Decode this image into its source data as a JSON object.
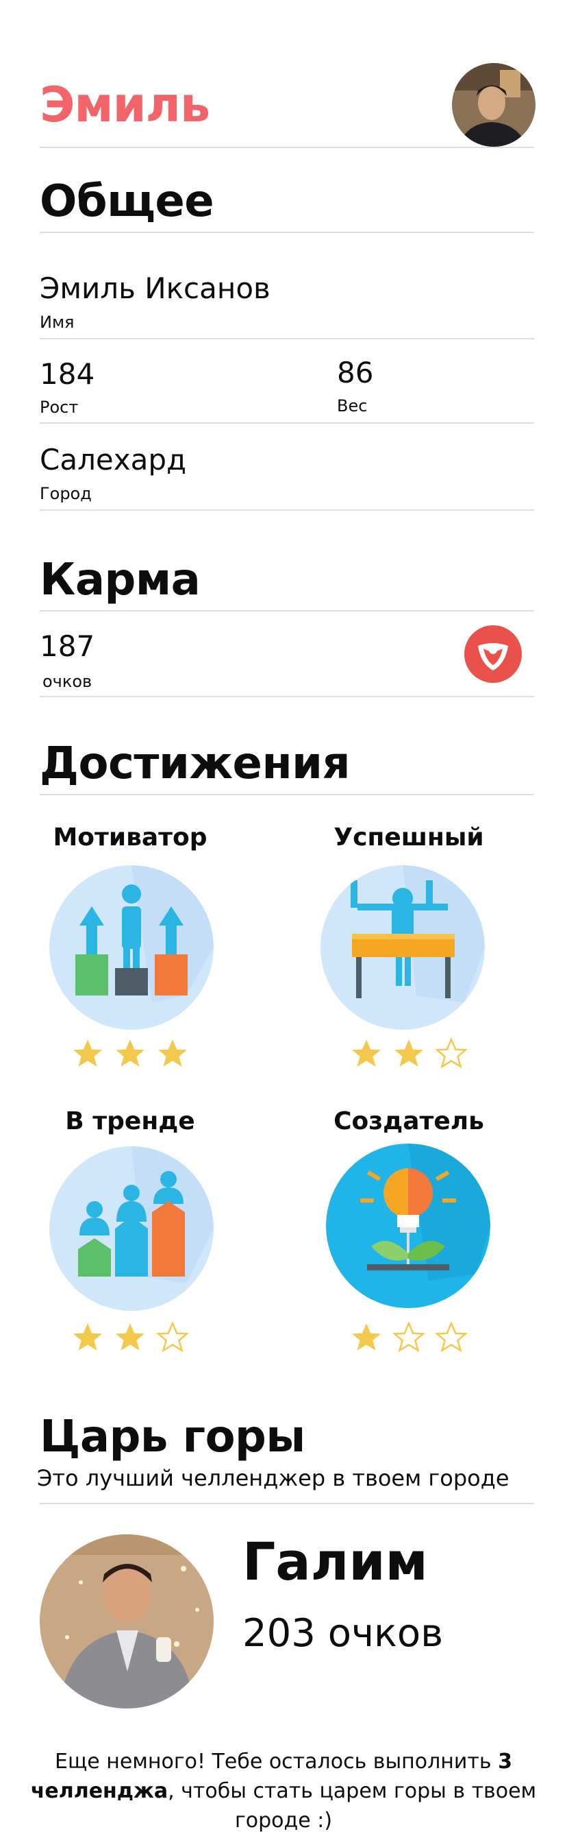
{
  "header": {
    "user_name": "Эмиль"
  },
  "general": {
    "title": "Общее",
    "name": {
      "value": "Эмиль Иксанов",
      "label": "Имя"
    },
    "height": {
      "value": "184",
      "label": "Рост"
    },
    "weight": {
      "value": "86",
      "label": "Вес"
    },
    "city": {
      "value": "Салехард",
      "label": "Город"
    }
  },
  "karma": {
    "title": "Карма",
    "value": "187",
    "label": "очков",
    "brand_color": "#e8524a"
  },
  "achievements": {
    "title": "Достижения",
    "items": [
      {
        "title": "Мотиватор",
        "icon": "motivator-icon",
        "stars_filled": 3,
        "stars_total": 3
      },
      {
        "title": "Успешный",
        "icon": "successful-icon",
        "stars_filled": 2,
        "stars_total": 3
      },
      {
        "title": "В тренде",
        "icon": "trending-icon",
        "stars_filled": 2,
        "stars_total": 3
      },
      {
        "title": "Создатель",
        "icon": "creator-icon",
        "stars_filled": 1,
        "stars_total": 3
      }
    ]
  },
  "king": {
    "title": "Царь горы",
    "subtitle": "Это лучший челленджер в твоем городе",
    "name": "Галим",
    "score": "203 очков"
  },
  "footer": {
    "text_before": "Еще немного! Тебе осталось выполнить ",
    "bold": "3 челленджа",
    "text_after": ", чтобы стать царем горы в твоем городе :)"
  },
  "colors": {
    "accent": "#f0646a",
    "star_filled": "#f2c94c",
    "divider": "#dddddd"
  }
}
